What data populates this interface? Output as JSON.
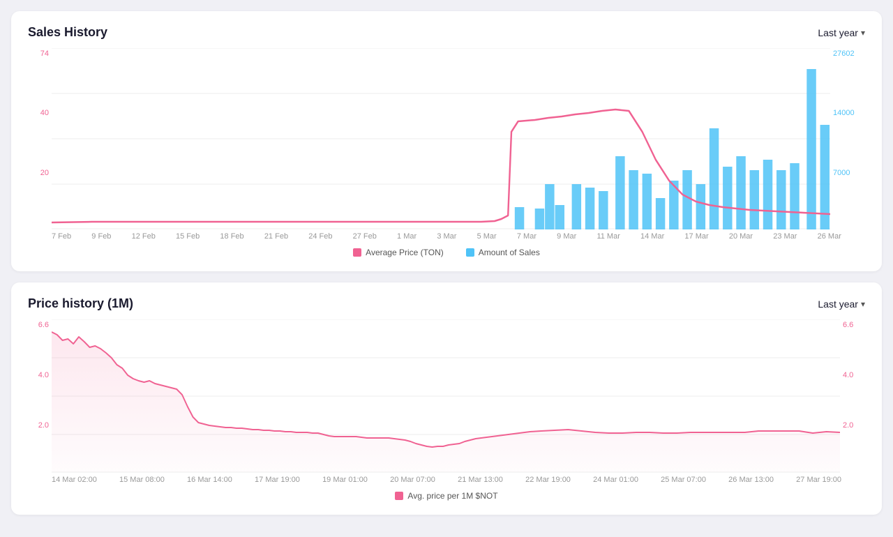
{
  "salesHistory": {
    "title": "Sales History",
    "period": "Last year",
    "yAxisLeft": [
      "74",
      "40",
      "20"
    ],
    "yAxisRight": [
      "27602",
      "14000",
      "7000"
    ],
    "xLabels": [
      "7 Feb",
      "9 Feb",
      "12 Feb",
      "15 Feb",
      "18 Feb",
      "21 Feb",
      "24 Feb",
      "27 Feb",
      "1 Mar",
      "3 Mar",
      "5 Mar",
      "7 Mar",
      "9 Mar",
      "11 Mar",
      "14 Mar",
      "17 Mar",
      "20 Mar",
      "23 Mar",
      "26 Mar"
    ],
    "legend": {
      "avgPrice": "Average Price (TON)",
      "amountSales": "Amount of Sales"
    }
  },
  "priceHistory": {
    "title": "Price history (1M)",
    "period": "Last year",
    "yAxisLeft": [
      "6.6",
      "4.0",
      "2.0"
    ],
    "yAxisRight": [
      "6.6",
      "4.0",
      "2.0"
    ],
    "xLabels": [
      "14 Mar 02:00",
      "15 Mar 08:00",
      "16 Mar 14:00",
      "17 Mar 19:00",
      "19 Mar 01:00",
      "20 Mar 07:00",
      "21 Mar 13:00",
      "22 Mar 19:00",
      "24 Mar 01:00",
      "25 Mar 07:00",
      "26 Mar 13:00",
      "27 Mar 19:00"
    ],
    "legend": "Avg. price per 1M $NOT"
  }
}
